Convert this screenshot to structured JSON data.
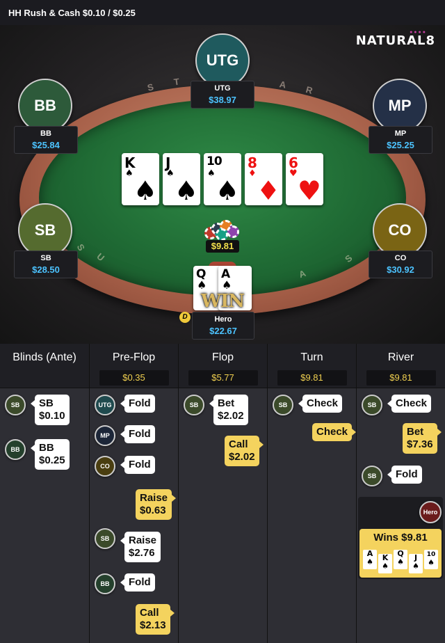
{
  "header": {
    "hand_type": "HH",
    "game": "Rush & Cash $0.10 / $0.25"
  },
  "brand": {
    "name": "NATURAL8"
  },
  "table": {
    "rail_letters": [
      "S",
      "T",
      "A",
      "R",
      "S",
      "U",
      "S",
      "A"
    ],
    "seats": {
      "utg": {
        "pos": "UTG",
        "name": "UTG",
        "stack": "$38.97",
        "color": "#1f5a5e"
      },
      "bb": {
        "pos": "BB",
        "name": "BB",
        "stack": "$25.84",
        "color": "#2d5a3a"
      },
      "mp": {
        "pos": "MP",
        "name": "MP",
        "stack": "$25.25",
        "color": "#243047"
      },
      "sb": {
        "pos": "SB",
        "name": "SB",
        "stack": "$28.50",
        "color": "#556b2f"
      },
      "co": {
        "pos": "CO",
        "name": "CO",
        "stack": "$30.92",
        "color": "#7a6414"
      },
      "hero": {
        "name": "Hero",
        "stack": "$22.67"
      }
    },
    "board": [
      {
        "rank": "K",
        "suit": "♠",
        "color": "black"
      },
      {
        "rank": "J",
        "suit": "♠",
        "color": "black"
      },
      {
        "rank": "10",
        "suit": "♠",
        "color": "black"
      },
      {
        "rank": "8",
        "suit": "♦",
        "color": "red"
      },
      {
        "rank": "6",
        "suit": "♥",
        "color": "red"
      }
    ],
    "hero_cards": [
      {
        "rank": "Q",
        "suit": "♠"
      },
      {
        "rank": "A",
        "suit": "♠"
      }
    ],
    "pot": "$9.81",
    "win_label": "WIN",
    "dealer_label": "D"
  },
  "streets": {
    "blinds": {
      "title": "Blinds (Ante)"
    },
    "preflop": {
      "title": "Pre-Flop",
      "pot": "$0.35"
    },
    "flop": {
      "title": "Flop",
      "pot": "$5.77"
    },
    "turn": {
      "title": "Turn",
      "pot": "$9.81"
    },
    "river": {
      "title": "River",
      "pot": "$9.81"
    }
  },
  "actions": {
    "blinds": [
      {
        "pos": "SB",
        "line1": "SB",
        "line2": "$0.10"
      },
      {
        "pos": "BB",
        "line1": "BB",
        "line2": "$0.25"
      }
    ],
    "preflop": [
      {
        "pos": "UTG",
        "line1": "Fold"
      },
      {
        "pos": "MP",
        "line1": "Fold"
      },
      {
        "pos": "CO",
        "line1": "Fold"
      },
      {
        "hero": true,
        "line1": "Raise",
        "line2": "$0.63"
      },
      {
        "pos": "SB",
        "line1": "Raise",
        "line2": "$2.76"
      },
      {
        "pos": "BB",
        "line1": "Fold"
      },
      {
        "hero": true,
        "line1": "Call",
        "line2": "$2.13"
      }
    ],
    "flop": [
      {
        "pos": "SB",
        "line1": "Bet",
        "line2": "$2.02"
      },
      {
        "hero": true,
        "line1": "Call",
        "line2": "$2.02"
      }
    ],
    "turn": [
      {
        "pos": "SB",
        "line1": "Check"
      },
      {
        "hero": true,
        "line1": "Check"
      }
    ],
    "river": [
      {
        "pos": "SB",
        "line1": "Check"
      },
      {
        "hero": true,
        "line1": "Bet",
        "line2": "$7.36"
      },
      {
        "pos": "SB",
        "line1": "Fold"
      }
    ]
  },
  "result": {
    "badge": "Hero",
    "text": "Wins $9.81",
    "cards": [
      {
        "rank": "A",
        "suit": "♠"
      },
      {
        "rank": "K",
        "suit": "♠"
      },
      {
        "rank": "Q",
        "suit": "♠"
      },
      {
        "rank": "J",
        "suit": "♠"
      },
      {
        "rank": "10",
        "suit": "♠"
      }
    ]
  }
}
